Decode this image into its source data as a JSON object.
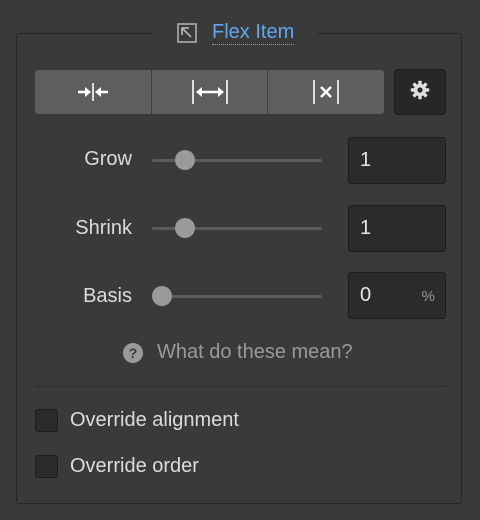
{
  "section": {
    "title": "Flex Item",
    "icon": "arrow-box-icon"
  },
  "sizing_buttons": [
    {
      "name": "shrink-icon",
      "label": "Shrink"
    },
    {
      "name": "grow-icon",
      "label": "Grow"
    },
    {
      "name": "none-icon",
      "label": "None"
    }
  ],
  "settings_button": {
    "icon": "gear-icon"
  },
  "grow": {
    "label": "Grow",
    "value": "1",
    "slider_fraction": 0.15
  },
  "shrink": {
    "label": "Shrink",
    "value": "1",
    "slider_fraction": 0.15
  },
  "basis": {
    "label": "Basis",
    "value": "0",
    "unit": "%",
    "slider_fraction": 0.0
  },
  "help": {
    "icon": "question-icon",
    "text": "What do these mean?"
  },
  "options": [
    {
      "label": "Override alignment",
      "checked": false
    },
    {
      "label": "Override order",
      "checked": false
    }
  ],
  "colors": {
    "background": "#3a3a3a",
    "accent": "#5fa8f0",
    "segment": "#5e5e5e"
  }
}
